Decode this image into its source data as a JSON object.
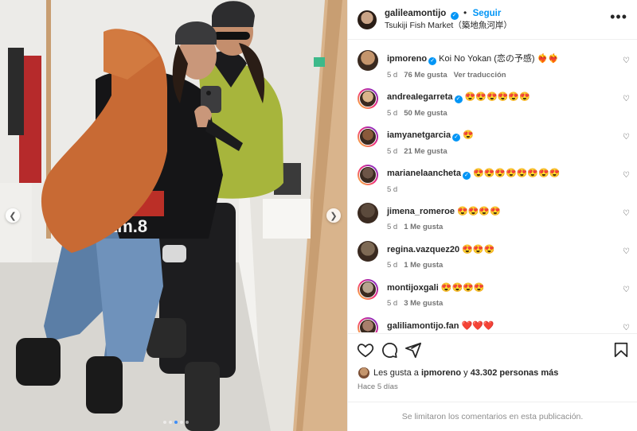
{
  "post": {
    "username": "galileamontijo",
    "follow_label": "Seguir",
    "separator": "•",
    "location": "Tsukiji Fish Market（築地魚河岸）",
    "more_label": "•••",
    "carousel": {
      "total": 5,
      "active_index": 2
    }
  },
  "comments": [
    {
      "user": "ipmoreno",
      "verified": true,
      "text": "Koi No Yokan (恋の予感) ❤️‍🔥❤️‍🔥",
      "age": "5 d",
      "likes": "76 Me gusta",
      "extra": "Ver traducción",
      "avatar_color": "#c4956c",
      "ring": false
    },
    {
      "user": "andreaIegarreta",
      "verified": true,
      "text": "😍😍😍😍😍😍",
      "age": "5 d",
      "likes": "50 Me gusta",
      "extra": "",
      "avatar_color": "#d9b48a",
      "ring": true
    },
    {
      "user": "iamyanetgarcia",
      "verified": true,
      "text": "😍",
      "age": "5 d",
      "likes": "21 Me gusta",
      "extra": "",
      "avatar_color": "#8a5a3b",
      "ring": true
    },
    {
      "user": "marianelaancheta",
      "verified": true,
      "text": "😍😍😍😍😍😍😍😍",
      "age": "5 d",
      "likes": "",
      "extra": "",
      "avatar_color": "#6d5547",
      "ring": true
    },
    {
      "user": "jimena_romeroe",
      "verified": false,
      "text": "😍😍😍😍",
      "age": "5 d",
      "likes": "1 Me gusta",
      "extra": "",
      "avatar_color": "#5b4a3c",
      "ring": false
    },
    {
      "user": "regina.vazquez20",
      "verified": false,
      "text": "😍😍😍",
      "age": "5 d",
      "likes": "1 Me gusta",
      "extra": "",
      "avatar_color": "#7e6a55",
      "ring": false
    },
    {
      "user": "montijoxgali",
      "verified": false,
      "text": "😍😍😍😍",
      "age": "5 d",
      "likes": "3 Me gusta",
      "extra": "",
      "avatar_color": "#b7a48f",
      "ring": true
    },
    {
      "user": "galiliamontijo.fan",
      "verified": false,
      "text": "❤️❤️❤️",
      "age": "",
      "likes": "",
      "extra": "",
      "avatar_color": "#a77f6b",
      "ring": true
    }
  ],
  "likes_summary": {
    "prefix": "Les gusta a",
    "user": "ipmoreno",
    "joiner": "y",
    "count": "43.302 personas más"
  },
  "time_ago": "Hace 5 días",
  "comments_limited": "Se limitaron los comentarios en esta publicación.",
  "colors": {
    "accent": "#0095f6",
    "muted": "#737373",
    "border": "#efefef"
  },
  "icons": [
    "chevron-left-icon",
    "chevron-right-icon",
    "heart-icon",
    "comment-icon",
    "share-icon",
    "bookmark-icon",
    "verified-icon",
    "more-icon"
  ]
}
